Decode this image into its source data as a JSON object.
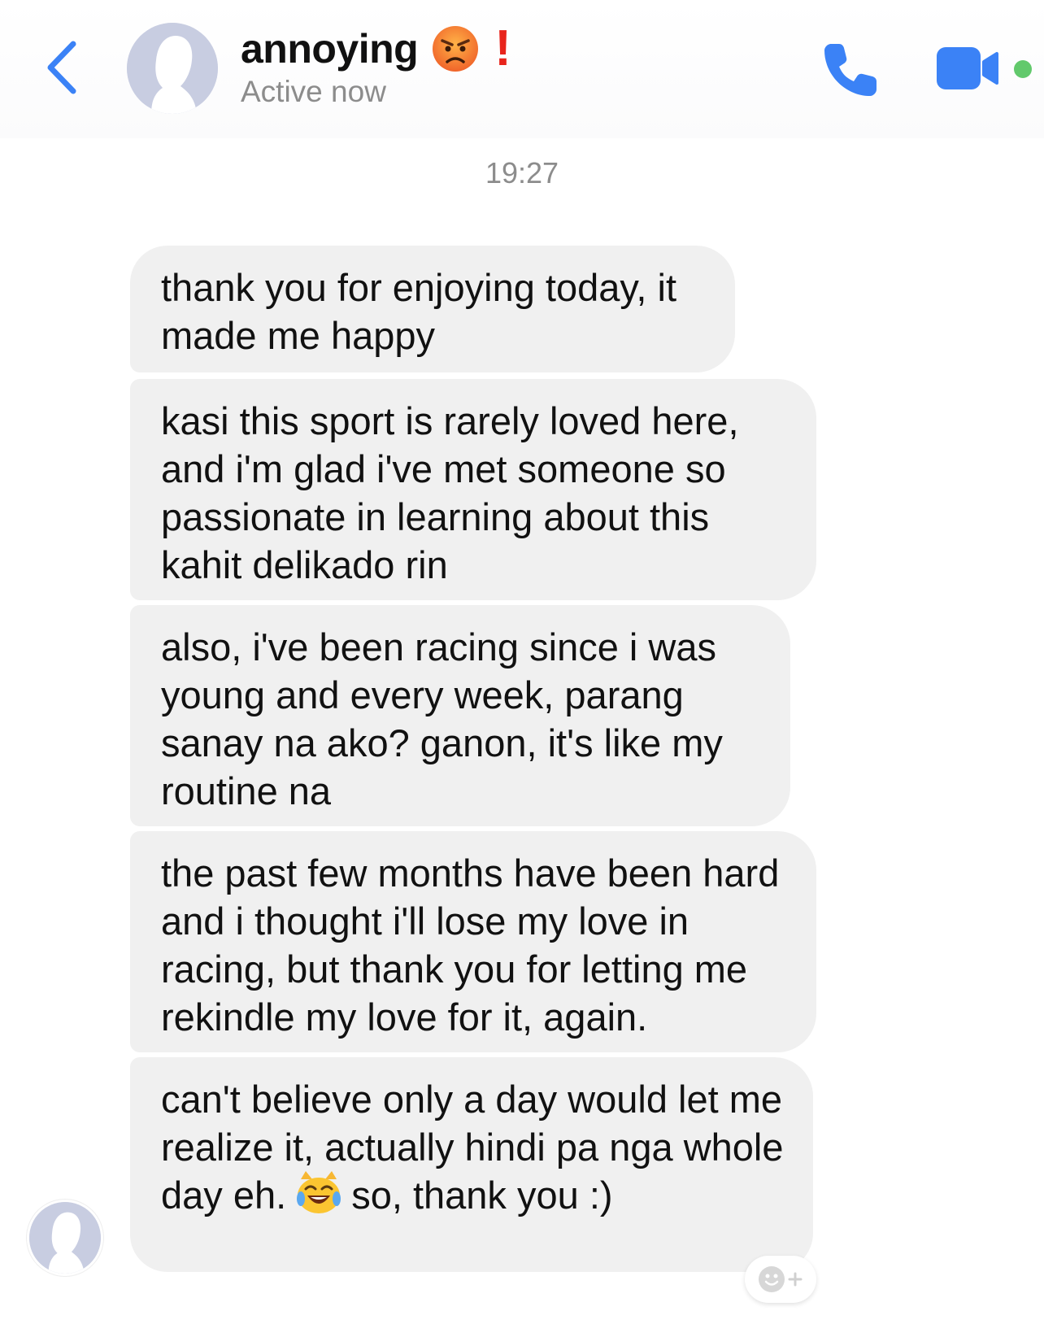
{
  "header": {
    "contact_name": "annoying",
    "name_emoji": "angry-face-emoji",
    "name_mark": "!",
    "status": "Active now",
    "icons": {
      "back": "chevron-left-icon",
      "call": "phone-icon",
      "video": "video-camera-icon"
    },
    "accent_color": "#3b82f6",
    "online_color": "#62c96c"
  },
  "conversation": {
    "timestamp": "19:27",
    "messages": [
      {
        "text": "thank you for enjoying today, it made me happy"
      },
      {
        "text": "kasi this sport is rarely loved here, and i'm glad i've met someone so passionate in learning about this kahit delikado rin"
      },
      {
        "text": "also, i've been racing since i was young and every week, parang sanay na ako? ganon, it's like my routine na"
      },
      {
        "text": "the past few months have been hard and i thought i'll lose my love in racing, but thank you for letting me rekindle my love for it, again."
      },
      {
        "text_before_emoji": "can't believe only a day would let me realize it, actually hindi pa nga whole day eh.",
        "emoji": "cat-tears-of-joy-emoji",
        "text_after_emoji": "so, thank you :)"
      }
    ],
    "bubble_color": "#f0f0f0"
  },
  "reaction_button": {
    "icons": [
      "smiley-icon",
      "plus-icon"
    ]
  }
}
